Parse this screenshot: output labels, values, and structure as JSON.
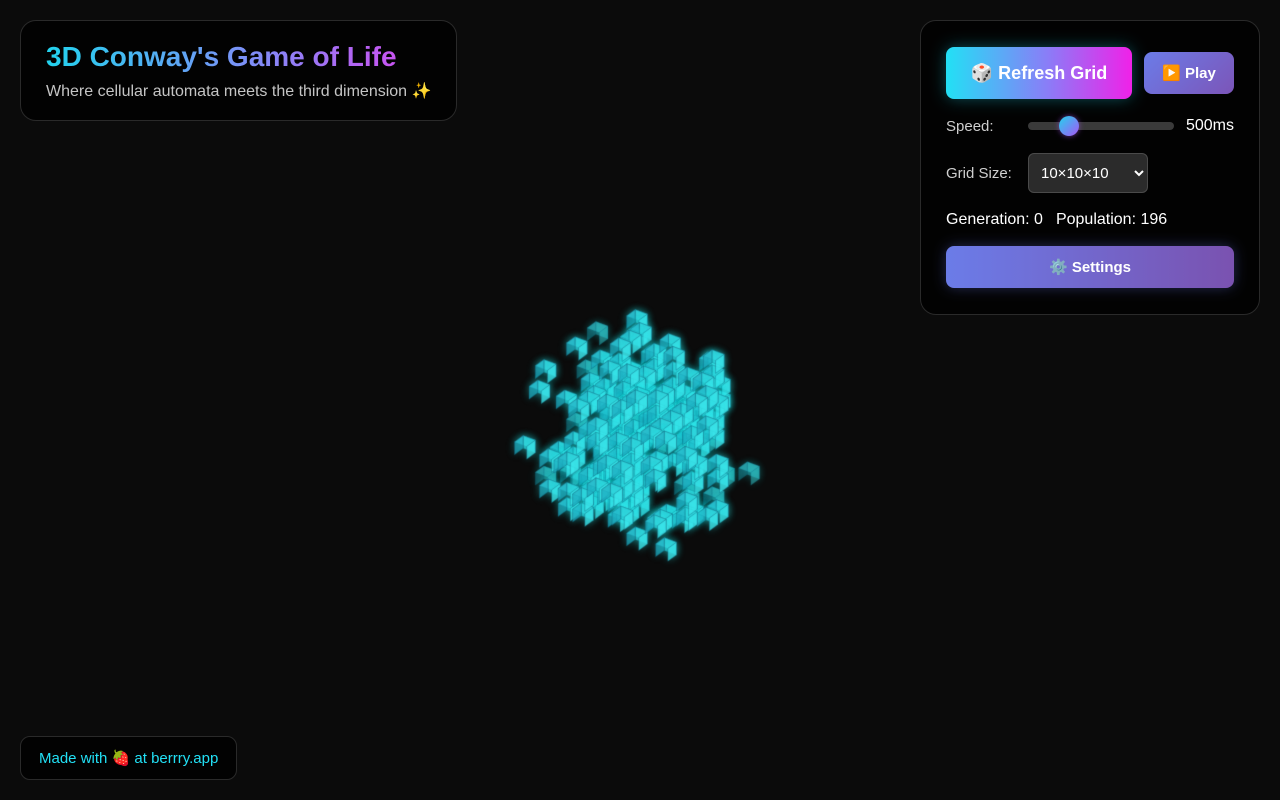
{
  "header": {
    "title": "3D Conway's Game of Life",
    "subtitle": "Where cellular automata meets the third dimension ✨"
  },
  "controls": {
    "refresh_label": "🎲 Refresh Grid",
    "play_label": "▶️ Play",
    "speed_label": "Speed:",
    "speed_value": "500ms",
    "speed_fraction": 0.25,
    "grid_size_label": "Grid Size:",
    "grid_size_selected": "10×10×10",
    "generation_text": "Generation: 0",
    "population_text": "Population: 196",
    "settings_label": "⚙️ Settings"
  },
  "footer": {
    "made_with": "Made with 🍓 at",
    "site": "berrry.app"
  },
  "colors": {
    "background": "#0b0b0b",
    "cell": "#3ff2f2",
    "accent_cyan": "#22e0f5",
    "accent_magenta": "#f021e8",
    "accent_indigo": "#6b7ce8"
  },
  "icons": {
    "refresh": "die-icon",
    "play": "play-icon",
    "settings": "gear-icon",
    "footer": "strawberry-icon"
  }
}
